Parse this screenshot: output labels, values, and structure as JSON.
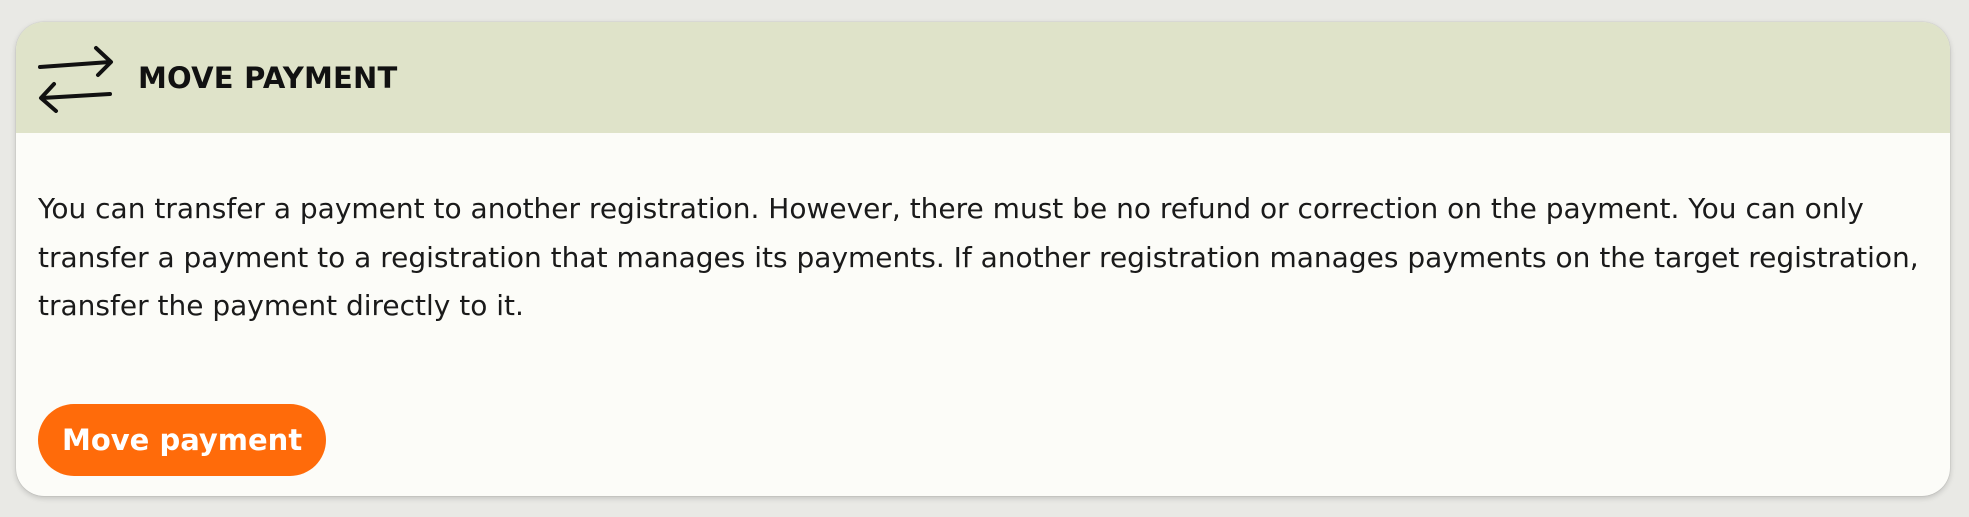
{
  "card": {
    "header": {
      "icon": "swap-arrows-icon",
      "title": "MOVE PAYMENT",
      "background": "#dfe3c9"
    },
    "description": "You can transfer a payment to another registration. However, there must be no refund or correction on the payment. You can only transfer a payment to a registration that manages its payments. If another registration manages payments on the target registration, transfer the payment directly to it.",
    "button": {
      "label": "Move payment",
      "color": "#ff6b0a"
    }
  }
}
